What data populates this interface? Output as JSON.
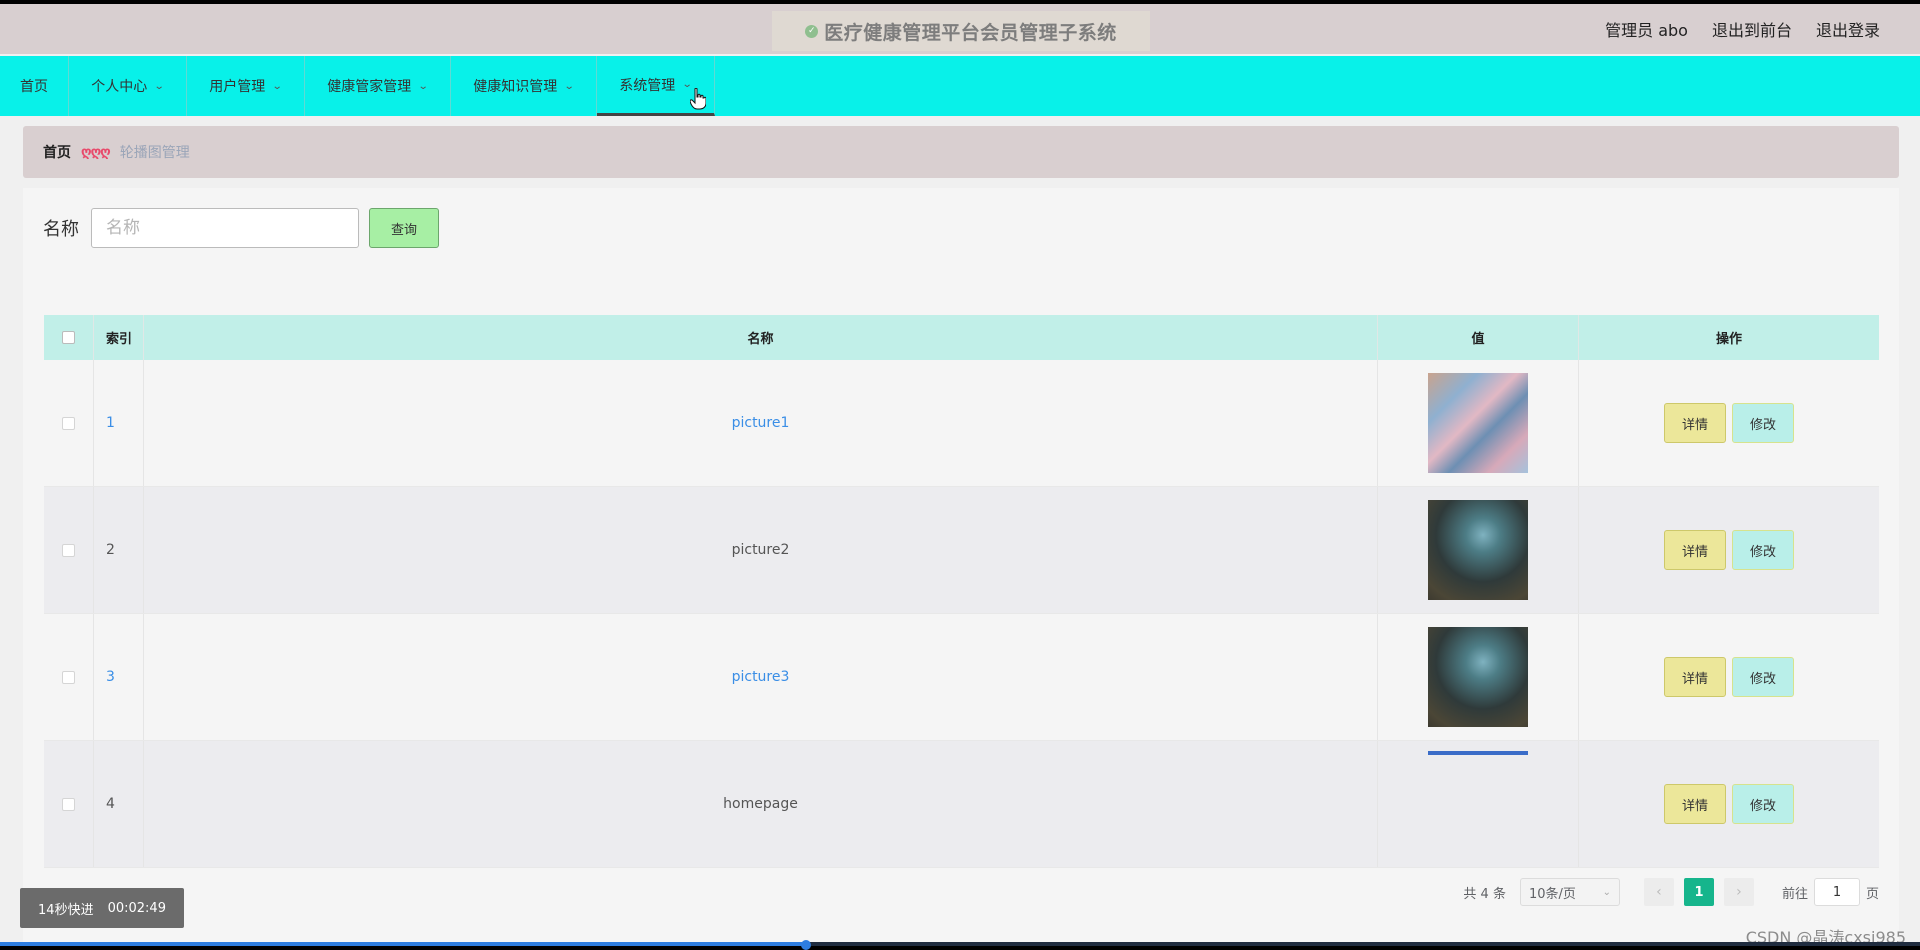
{
  "app": {
    "title": "医疗健康管理平台会员管理子系统",
    "user": "管理员 abo",
    "exit_front": "退出到前台",
    "logout": "退出登录"
  },
  "nav": {
    "items": [
      {
        "label": "首页"
      },
      {
        "label": "个人中心"
      },
      {
        "label": "用户管理"
      },
      {
        "label": "健康管家管理"
      },
      {
        "label": "健康知识管理"
      },
      {
        "label": "系统管理"
      }
    ],
    "active_index": 5
  },
  "breadcrumb": {
    "home": "首页",
    "separator": "ღღღ",
    "current": "轮播图管理"
  },
  "search": {
    "label": "名称",
    "placeholder": "名称",
    "button": "查询"
  },
  "table": {
    "headers": {
      "index": "索引",
      "name": "名称",
      "value": "值",
      "ops": "操作"
    },
    "rows": [
      {
        "index": "1",
        "name": "picture1",
        "thumb": "thumb-a",
        "link": true
      },
      {
        "index": "2",
        "name": "picture2",
        "thumb": "thumb-b",
        "link": false
      },
      {
        "index": "3",
        "name": "picture3",
        "thumb": "thumb-b",
        "link": true
      },
      {
        "index": "4",
        "name": "homepage",
        "thumb": "thumb-c",
        "link": false
      }
    ],
    "detail_label": "详情",
    "edit_label": "修改"
  },
  "pagination": {
    "total": "共 4 条",
    "page_size": "10条/页",
    "prev": "‹",
    "current_page": "1",
    "next": "›",
    "goto_prefix": "前往",
    "goto_value": "1",
    "goto_suffix": "页"
  },
  "video": {
    "speed": "14秒快进",
    "time": "00:02:49",
    "progress": 0.42
  },
  "watermark": "CSDN @晶涛cxsj985",
  "colors": {
    "nav_bg": "#08f1e9",
    "header_bg": "#d8cfd0",
    "table_header_bg": "#c1efe8",
    "search_btn_bg": "#a7efa4",
    "detail_btn_bg": "#ece79a",
    "edit_btn_bg": "#b9efe9",
    "pager_active": "#16b58c"
  }
}
